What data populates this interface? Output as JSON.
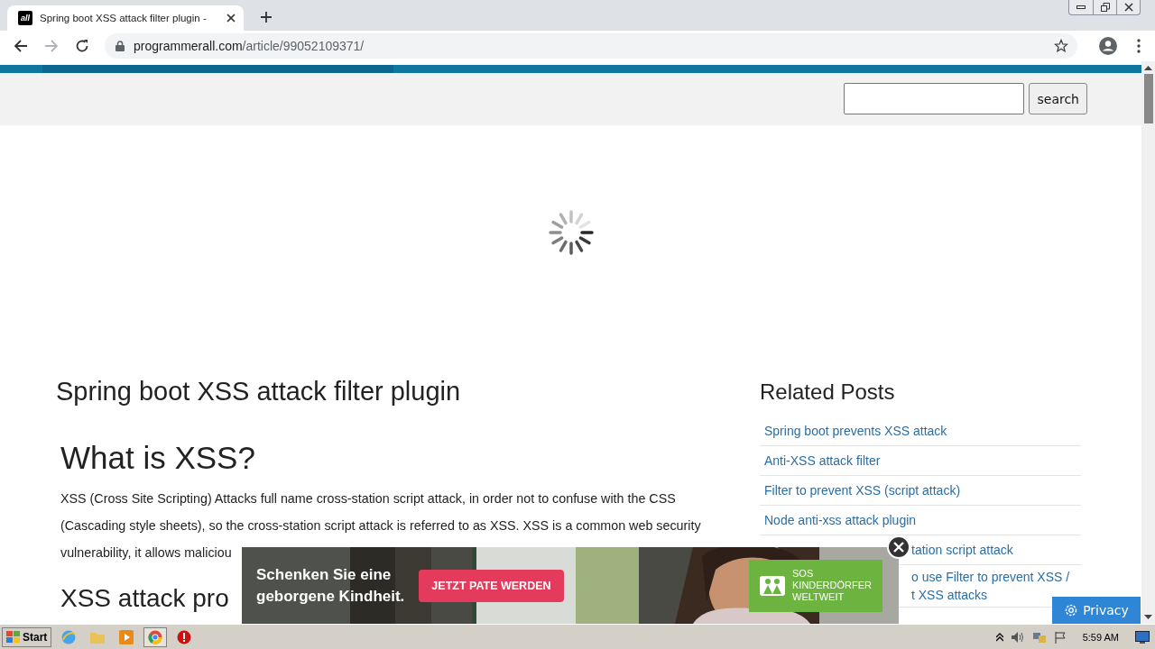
{
  "browser": {
    "tab": {
      "favicon_text": "all",
      "title": "Spring boot XSS attack filter plugin -",
      "selected": true
    },
    "forward_disabled": true,
    "url_host": "programmerall.com",
    "url_path": "/article/99052109371/"
  },
  "header": {
    "search_button": "search"
  },
  "article": {
    "title": "Spring boot XSS attack filter plugin",
    "sections": [
      {
        "heading": "What is XSS?",
        "lines": [
          "XSS (Cross Site Scripting) Attacks full name cross-station script attack, in order not to confuse with the CSS",
          "(Cascading style sheets), so the cross-station script attack is referred to as XSS. XSS is a common web security",
          "vulnerability, it allows maliciou"
        ]
      },
      {
        "heading": "XSS attack pro"
      }
    ]
  },
  "related": {
    "title": "Related Posts",
    "items": [
      {
        "kind": "link",
        "lines": [
          "Spring boot prevents XSS attack"
        ]
      },
      {
        "kind": "link",
        "lines": [
          "Anti-XSS attack filter"
        ]
      },
      {
        "kind": "link",
        "lines": [
          "Filter to prevent XSS (script attack)"
        ]
      },
      {
        "kind": "link",
        "lines": [
          "Node anti-xss attack plugin"
        ]
      },
      {
        "kind": "partial",
        "lines": [
          "tation script attack"
        ]
      },
      {
        "kind": "partial",
        "lines": [
          "o use Filter to prevent XSS /",
          "t XSS attacks"
        ]
      }
    ]
  },
  "ad": {
    "headline_lines": [
      "Schenken Sie eine",
      "geborgene Kindheit."
    ],
    "button": "JETZT PATE WERDEN",
    "logo_lines": [
      "SOS",
      "KINDERDÖRFER",
      "WELTWEIT"
    ]
  },
  "privacy_button": "Privacy",
  "taskbar": {
    "start": "Start",
    "clock": "5:59 AM"
  }
}
